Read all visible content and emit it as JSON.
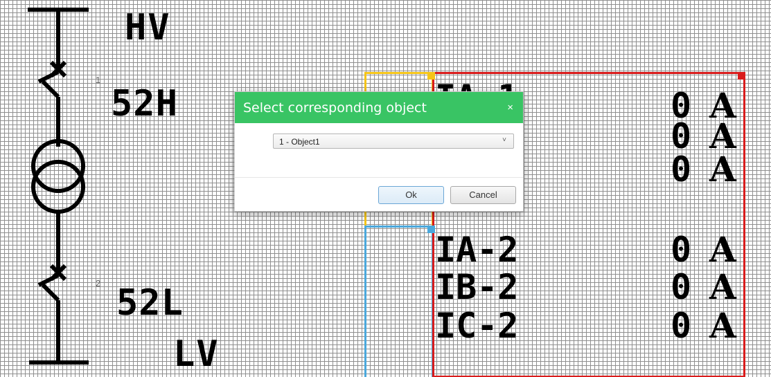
{
  "diagram": {
    "hv_label": "HV",
    "lv_label": "LV",
    "breakers": [
      {
        "index": "1",
        "label": "52H"
      },
      {
        "index": "2",
        "label": "52L"
      }
    ],
    "measurements_group1": [
      {
        "name": "IA-1",
        "value": "0",
        "unit": "A"
      },
      {
        "name": "",
        "value": "0",
        "unit": "A"
      },
      {
        "name": "",
        "value": "0",
        "unit": "A"
      }
    ],
    "measurements_group2": [
      {
        "name": "IA-2",
        "value": "0",
        "unit": "A"
      },
      {
        "name": "IB-2",
        "value": "0",
        "unit": "A"
      },
      {
        "name": "IC-2",
        "value": "0",
        "unit": "A"
      }
    ]
  },
  "dialog": {
    "title": "Select corresponding object",
    "close_glyph": "×",
    "select_value": "1 - Object1",
    "select_chevron": "˅",
    "ok_label": "Ok",
    "cancel_label": "Cancel",
    "header_color": "#39c464"
  },
  "selection_colors": {
    "red": "#d91c1c",
    "yellow": "#f5c518",
    "blue": "#4aa8dc"
  }
}
